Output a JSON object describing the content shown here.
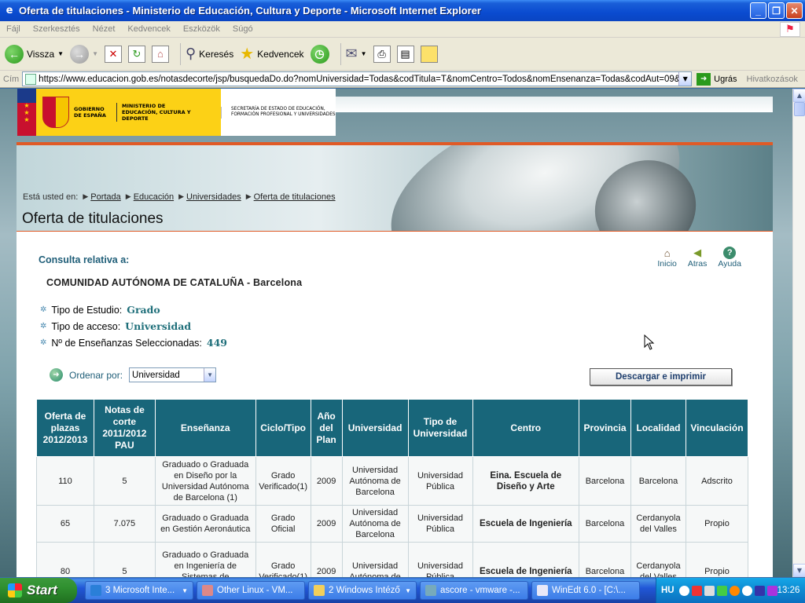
{
  "window": {
    "title": "Oferta de titulaciones - Ministerio de Educación, Cultura y Deporte - Microsoft Internet Explorer",
    "buttons": {
      "minimize": "_",
      "maximize": "❐",
      "close": "✕"
    }
  },
  "menubar": {
    "items": [
      "Fájl",
      "Szerkesztés",
      "Nézet",
      "Kedvencek",
      "Eszközök",
      "Súgó"
    ]
  },
  "toolbar": {
    "back": "Vissza",
    "search": "Keresés",
    "favorites": "Kedvencek"
  },
  "addressbar": {
    "label": "Cím",
    "url": "https://www.educacion.gob.es/notasdecorte/jsp/busquedaDo.do?nomUniversidad=Todas&codTitula=T&nomCentro=Todos&nomEnsenanza=Todas&codAut=09&codProv",
    "go": "Ugrás",
    "links": "Hivatkozások"
  },
  "banner": {
    "gobierno": "GOBIERNO DE ESPAÑA",
    "ministerio": "MINISTERIO DE EDUCACIÓN, CULTURA Y DEPORTE",
    "secretaria": "SECRETARÍA DE ESTADO DE EDUCACIÓN, FORMACIÓN PROFESIONAL Y UNIVERSIDADES"
  },
  "breadcrumb": {
    "prefix": "Está usted en:",
    "items": [
      "Portada",
      "Educación",
      "Universidades",
      "Oferta de titulaciones"
    ]
  },
  "page": {
    "title": "Oferta de titulaciones",
    "consulta": "Consulta relativa a:",
    "region": "COMUNIDAD AUTÓNOMA DE CATALUÑA - Barcelona",
    "facts": [
      {
        "label": "Tipo de Estudio:",
        "value": "Grado"
      },
      {
        "label": "Tipo de acceso:",
        "value": "Universidad"
      },
      {
        "label": "Nº de Enseñanzas Seleccionadas:",
        "value": "449"
      }
    ],
    "nav_icons": {
      "inicio": "Inicio",
      "atras": "Atras",
      "ayuda": "Ayuda"
    },
    "ordenar_label": "Ordenar por:",
    "ordenar_value": "Universidad",
    "descargar": "Descargar e imprimir"
  },
  "table": {
    "headers": [
      "Oferta de plazas 2012/2013",
      "Notas de corte 2011/2012 PAU",
      "Enseñanza",
      "Ciclo/Tipo",
      "Año del Plan",
      "Universidad",
      "Tipo de Universidad",
      "Centro",
      "Provincia",
      "Localidad",
      "Vinculación"
    ],
    "rows": [
      [
        "110",
        "5",
        "Graduado o Graduada en Diseño por la Universidad Autónoma de Barcelona (1)",
        "Grado Verificado(1)",
        "2009",
        "Universidad Autónoma de Barcelona",
        "Universidad Pública",
        "Eina. Escuela de Diseño y Arte",
        "Barcelona",
        "Barcelona",
        "Adscrito"
      ],
      [
        "65",
        "7.075",
        "Graduado o Graduada en Gestión Aeronáutica",
        "Grado Oficial",
        "2009",
        "Universidad Autónoma de Barcelona",
        "Universidad Pública",
        "Escuela de Ingeniería",
        "Barcelona",
        "Cerdanyola del Valles",
        "Propio"
      ],
      [
        "80",
        "5",
        "Graduado o Graduada en Ingeniería de Sistemas de Telecomunicación por la",
        "Grado Verificado(1)",
        "2009",
        "Universidad Autónoma de",
        "Universidad Pública",
        "Escuela de Ingeniería",
        "Barcelona",
        "Cerdanyola del Valles",
        "Propio"
      ]
    ]
  },
  "taskbar": {
    "start": "Start",
    "tasks": [
      "3 Microsoft Inte...",
      "Other Linux - VM...",
      "2 Windows Intéző",
      "ascore - vmware -...",
      "WinEdt 6.0 - [C:\\..."
    ],
    "lang": "HU",
    "clock": "13:26"
  }
}
